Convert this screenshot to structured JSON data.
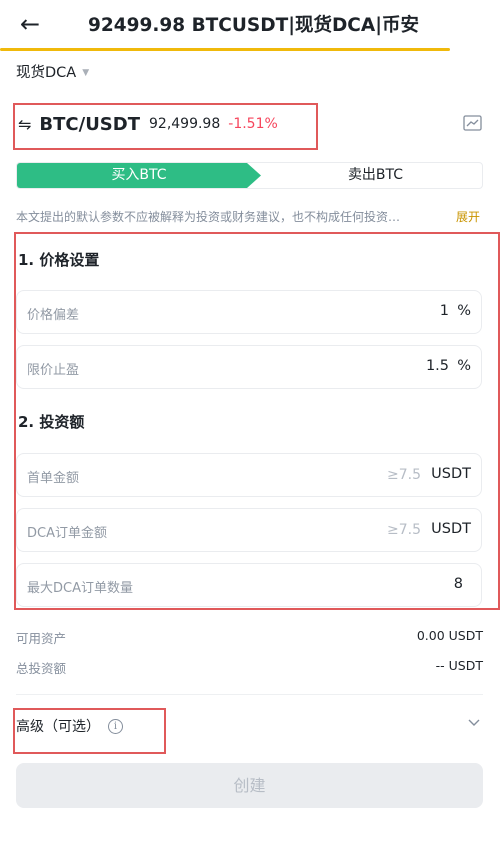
{
  "header": {
    "title": "92499.98 BTCUSDT|现货DCA|币安",
    "back_icon": "arrow-left-icon"
  },
  "mode": {
    "label": "现货DCA",
    "caret_icon": "caret-down-icon"
  },
  "pair": {
    "swap_icon": "swap-icon",
    "symbol": "BTC/USDT",
    "price": "92,499.98",
    "change": "-1.51%",
    "change_color": "#f6465d",
    "chart_icon": "chart-icon"
  },
  "tabs": {
    "buy": "买入BTC",
    "sell": "卖出BTC",
    "active": "buy",
    "buy_color": "#2ebd85"
  },
  "disclaimer": {
    "text": "本文提出的默认参数不应被解释为投资或财务建议，也不构成任何投资…",
    "expand": "展开"
  },
  "price_settings": {
    "title": "1. 价格设置",
    "deviation": {
      "label": "价格偏差",
      "value": "1",
      "unit": "%"
    },
    "take_profit": {
      "label": "限价止盈",
      "value": "1.5",
      "unit": "%"
    }
  },
  "investment": {
    "title": "2. 投资额",
    "first_order": {
      "label": "首单金额",
      "placeholder": "≥7.5",
      "unit": "USDT"
    },
    "dca_order": {
      "label": "DCA订单金额",
      "placeholder": "≥7.5",
      "unit": "USDT"
    },
    "max_orders": {
      "label": "最大DCA订单数量",
      "value": "8"
    }
  },
  "balances": {
    "available_label": "可用资产",
    "available_value": "0.00 USDT",
    "total_label": "总投资额",
    "total_value": "-- USDT"
  },
  "advanced": {
    "label": "高级（可选）",
    "info_icon": "info-icon",
    "chevron_icon": "chevron-down-icon"
  },
  "create_button": "创建",
  "colors": {
    "accent": "#f0b90b",
    "highlight_box": "#e0595a"
  }
}
